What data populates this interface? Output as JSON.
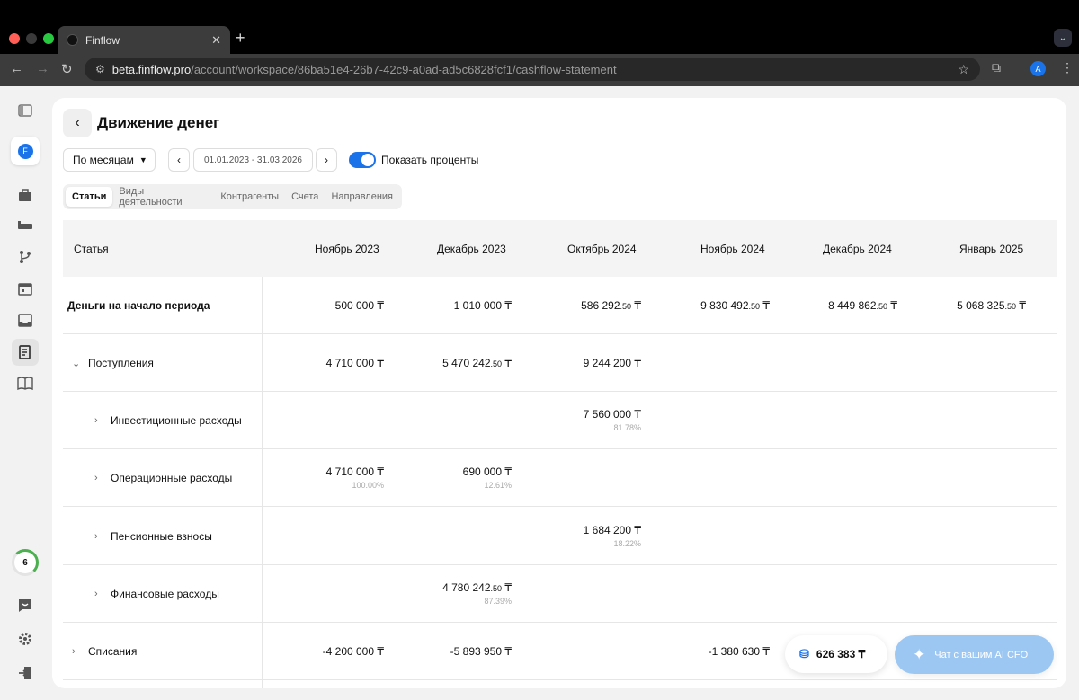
{
  "browser": {
    "tab_title": "Finflow",
    "tab_close": "✕",
    "new_tab": "+",
    "url_host": "beta.finflow.pro",
    "url_path": "/account/workspace/86ba51e4-26b7-42c9-a0ad-ad5c6828fcf1/cashflow-statement",
    "profile_initial": "A"
  },
  "sidebar": {
    "workspace_initial": "F",
    "counter": "6"
  },
  "page": {
    "title": "Движение денег"
  },
  "controls": {
    "period": "По месяцам",
    "date_range": "01.01.2023 - 31.03.2026",
    "toggle_label": "Показать проценты",
    "toggle_on": true
  },
  "tabs": [
    "Статьи",
    "Виды деятельности",
    "Контрагенты",
    "Счета",
    "Направления"
  ],
  "table": {
    "header_label": "Статья",
    "columns": [
      "Ноябрь 2023",
      "Декабрь 2023",
      "Октябрь 2024",
      "Ноябрь 2024",
      "Декабрь 2024",
      "Январь 2025"
    ],
    "rows": [
      {
        "label": "Деньги на начало периода",
        "values": [
          {
            "main": "500 000",
            "dec": "",
            "cur": " ₸",
            "pct": ""
          },
          {
            "main": "1 010 000",
            "dec": "",
            "cur": " ₸",
            "pct": ""
          },
          {
            "main": "586 292",
            "dec": ".50",
            "cur": " ₸",
            "pct": ""
          },
          {
            "main": "9 830 492",
            "dec": ".50",
            "cur": " ₸",
            "pct": ""
          },
          {
            "main": "8 449 862",
            "dec": ".50",
            "cur": " ₸",
            "pct": ""
          },
          {
            "main": "5 068 325",
            "dec": ".50",
            "cur": " ₸",
            "pct": ""
          }
        ]
      },
      {
        "label": "Поступления",
        "chevron": "⌄",
        "values": [
          {
            "main": "4 710 000",
            "dec": "",
            "cur": " ₸",
            "pct": ""
          },
          {
            "main": "5 470 242",
            "dec": ".50",
            "cur": " ₸",
            "pct": ""
          },
          {
            "main": "9 244 200",
            "dec": "",
            "cur": " ₸",
            "pct": ""
          },
          {
            "main": "",
            "dec": "",
            "cur": "",
            "pct": ""
          },
          {
            "main": "",
            "dec": "",
            "cur": "",
            "pct": ""
          },
          {
            "main": "",
            "dec": "",
            "cur": "",
            "pct": ""
          }
        ]
      },
      {
        "label": "Инвестиционные расходы",
        "chevron": "›",
        "values": [
          {
            "main": "",
            "dec": "",
            "cur": "",
            "pct": ""
          },
          {
            "main": "",
            "dec": "",
            "cur": "",
            "pct": ""
          },
          {
            "main": "7 560 000",
            "dec": "",
            "cur": " ₸",
            "pct": "81.78%"
          },
          {
            "main": "",
            "dec": "",
            "cur": "",
            "pct": ""
          },
          {
            "main": "",
            "dec": "",
            "cur": "",
            "pct": ""
          },
          {
            "main": "",
            "dec": "",
            "cur": "",
            "pct": ""
          }
        ]
      },
      {
        "label": "Операционные расходы",
        "chevron": "›",
        "values": [
          {
            "main": "4 710 000",
            "dec": "",
            "cur": " ₸",
            "pct": "100.00%"
          },
          {
            "main": "690 000",
            "dec": "",
            "cur": " ₸",
            "pct": "12.61%"
          },
          {
            "main": "",
            "dec": "",
            "cur": "",
            "pct": ""
          },
          {
            "main": "",
            "dec": "",
            "cur": "",
            "pct": ""
          },
          {
            "main": "",
            "dec": "",
            "cur": "",
            "pct": ""
          },
          {
            "main": "",
            "dec": "",
            "cur": "",
            "pct": ""
          }
        ]
      },
      {
        "label": "Пенсионные взносы",
        "chevron": "›",
        "values": [
          {
            "main": "",
            "dec": "",
            "cur": "",
            "pct": ""
          },
          {
            "main": "",
            "dec": "",
            "cur": "",
            "pct": ""
          },
          {
            "main": "1 684 200",
            "dec": "",
            "cur": " ₸",
            "pct": "18.22%"
          },
          {
            "main": "",
            "dec": "",
            "cur": "",
            "pct": ""
          },
          {
            "main": "",
            "dec": "",
            "cur": "",
            "pct": ""
          },
          {
            "main": "",
            "dec": "",
            "cur": "",
            "pct": ""
          }
        ]
      },
      {
        "label": "Финансовые расходы",
        "chevron": "›",
        "values": [
          {
            "main": "",
            "dec": "",
            "cur": "",
            "pct": ""
          },
          {
            "main": "4 780 242",
            "dec": ".50",
            "cur": " ₸",
            "pct": "87.39%"
          },
          {
            "main": "",
            "dec": "",
            "cur": "",
            "pct": ""
          },
          {
            "main": "",
            "dec": "",
            "cur": "",
            "pct": ""
          },
          {
            "main": "",
            "dec": "",
            "cur": "",
            "pct": ""
          },
          {
            "main": "",
            "dec": "",
            "cur": "",
            "pct": ""
          }
        ]
      },
      {
        "label": "Списания",
        "chevron": "›",
        "values": [
          {
            "main": "-4 200 000",
            "dec": "",
            "cur": " ₸",
            "pct": ""
          },
          {
            "main": "-5 893 950",
            "dec": "",
            "cur": " ₸",
            "pct": ""
          },
          {
            "main": "",
            "dec": "",
            "cur": "",
            "pct": ""
          },
          {
            "main": "-1 380 630",
            "dec": "",
            "cur": " ₸",
            "pct": ""
          },
          {
            "main": "",
            "dec": "",
            "cur": "",
            "pct": ""
          },
          {
            "main": "",
            "dec": "",
            "cur": "",
            "pct": ""
          }
        ]
      }
    ]
  },
  "floating": {
    "balance": "626 383 ₸",
    "ai_label": "Чат с вашим AI CFO"
  },
  "colors": {
    "accent": "#1a73e8",
    "ai_button": "#9cc7f3"
  }
}
